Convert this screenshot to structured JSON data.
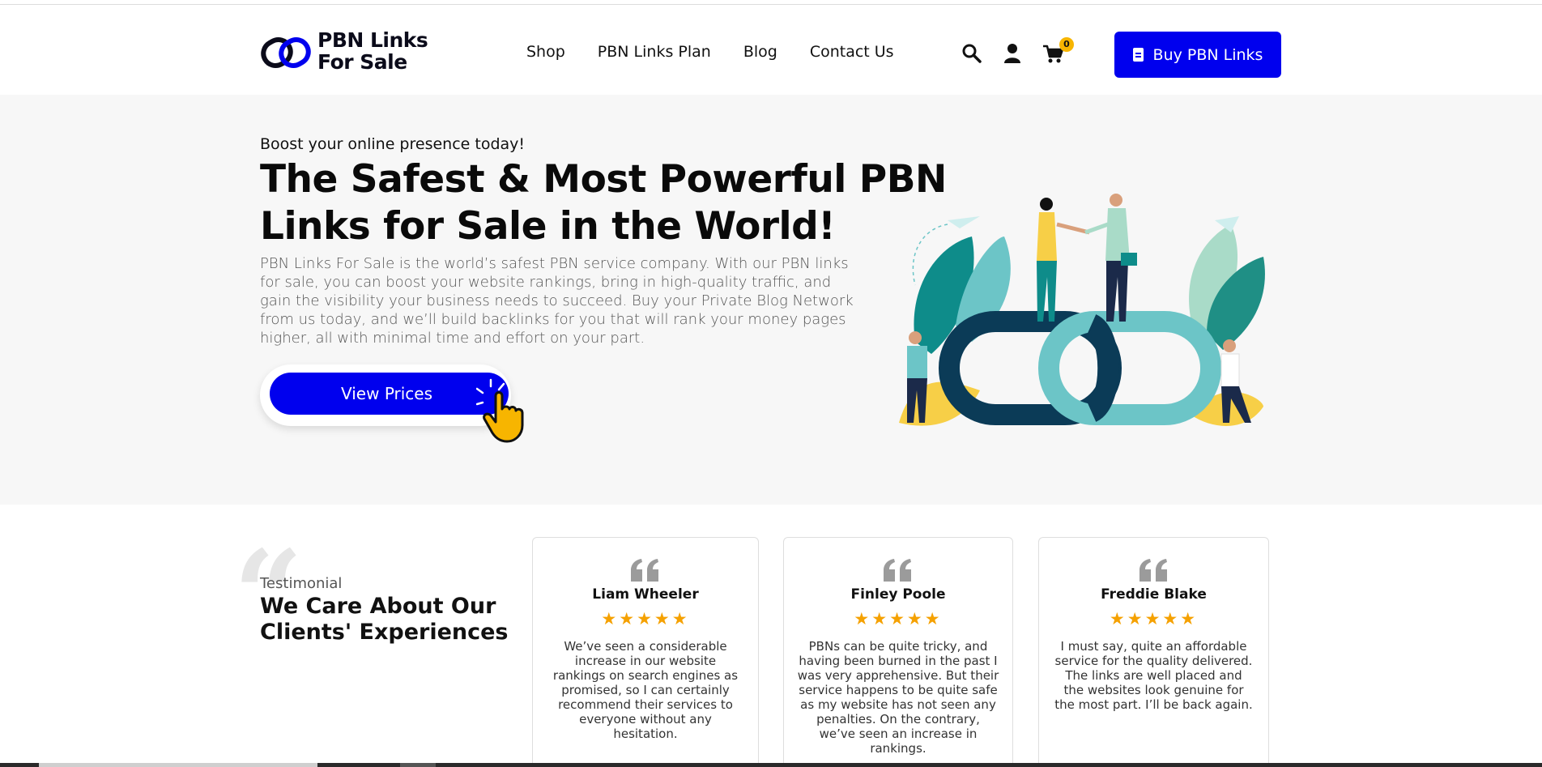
{
  "header": {
    "logo_line1": "PBN Links",
    "logo_line2": "For Sale",
    "nav": [
      "Shop",
      "PBN Links Plan",
      "Blog",
      "Contact Us"
    ],
    "cart_count": "0",
    "buy_button": "Buy PBN Links"
  },
  "hero": {
    "eyebrow": "Boost your online presence today!",
    "title": "The Safest & Most Powerful PBN Links for Sale in the World!",
    "description": "PBN Links For Sale is the world’s safest PBN service company. With our PBN links for sale, you can boost your website rankings, bring in high-quality traffic, and gain the visibility your business needs to succeed. Buy your Private Blog Network from us today, and we’ll build backlinks for you that will rank your money pages higher, all with minimal time and effort on your part.",
    "cta": "View Prices"
  },
  "testimonials": {
    "subtitle": "Testimonial",
    "title": "We Care About Our Clients' Experiences",
    "items": [
      {
        "name": "Liam Wheeler",
        "stars": "★★★★★",
        "text": "We’ve seen a considerable increase in our website rankings on search engines as promised, so I can certainly recommend their services to everyone without any hesitation."
      },
      {
        "name": "Finley Poole",
        "stars": "★★★★★",
        "text": "PBNs can be quite tricky, and having been burned in the past I was very apprehensive. But their service happens to be quite safe as my website has not seen any penalties. On the contrary, we’ve seen an increase in rankings."
      },
      {
        "name": "Freddie Blake",
        "stars": "★★★★★",
        "text": "I must say, quite an affordable service for the quality delivered. The links are well placed and the websites look genuine for the most part. I’ll be back again."
      }
    ]
  },
  "colors": {
    "accent": "#0000ee",
    "star": "#f5a100",
    "badge": "#f7b500",
    "hero_bg": "#f7f7f7"
  },
  "icons": [
    "search-icon",
    "user-icon",
    "cart-icon",
    "document-icon",
    "quote-icon",
    "pointing-hand-icon"
  ]
}
